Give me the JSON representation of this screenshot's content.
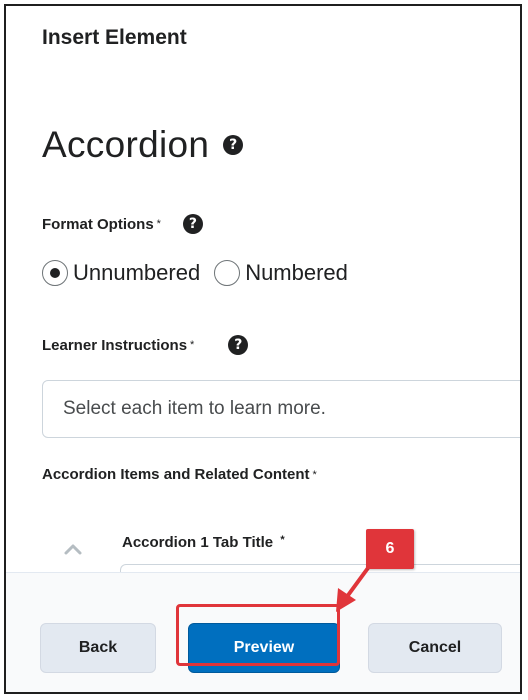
{
  "dialog": {
    "title": "Insert Element"
  },
  "element": {
    "heading": "Accordion"
  },
  "format_options": {
    "label": "Format Options",
    "required_mark": "*",
    "options": [
      {
        "label": "Unnumbered",
        "selected": true
      },
      {
        "label": "Numbered",
        "selected": false
      }
    ]
  },
  "learner_instructions": {
    "label": "Learner Instructions",
    "required_mark": "*",
    "value": "Select each item to learn more."
  },
  "accordion_items": {
    "label": "Accordion Items and Related Content",
    "required_mark": "*",
    "first_tab_label": "Accordion 1 Tab Title",
    "first_tab_required_mark": "*"
  },
  "footer": {
    "back_label": "Back",
    "preview_label": "Preview",
    "cancel_label": "Cancel"
  },
  "annotation": {
    "step_number": "6"
  },
  "colors": {
    "primary": "#006fbf",
    "highlight": "#e0353a",
    "secondary_button": "#e3e9f1"
  },
  "icons": [
    "help-icon",
    "radio-selected",
    "radio-unselected",
    "chevron-up-icon",
    "arrow-annotation"
  ]
}
